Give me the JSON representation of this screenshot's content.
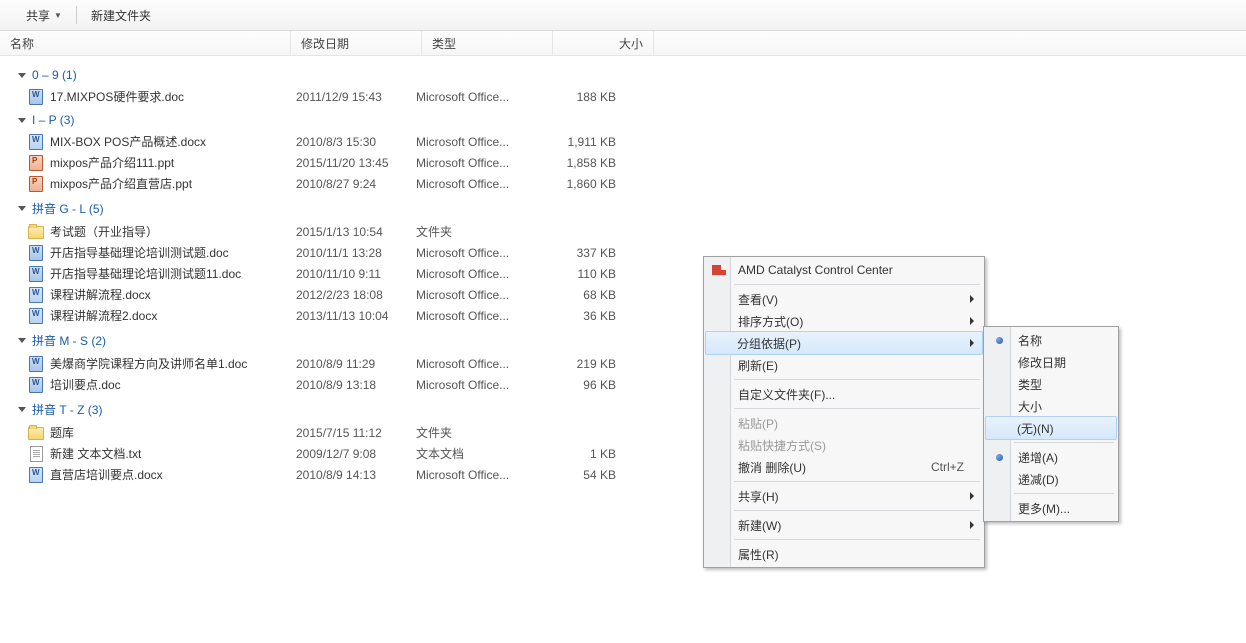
{
  "toolbar": {
    "share": "共享",
    "newFolder": "新建文件夹"
  },
  "columns": {
    "name": "名称",
    "date": "修改日期",
    "type": "类型",
    "size": "大小"
  },
  "groups": [
    {
      "label": "0 – 9 (1)",
      "items": [
        {
          "icon": "doc",
          "name": "17.MIXPOS硬件要求.doc",
          "date": "2011/12/9 15:43",
          "type": "Microsoft Office...",
          "size": "188 KB"
        }
      ]
    },
    {
      "label": "I – P (3)",
      "items": [
        {
          "icon": "docx",
          "name": "MIX-BOX POS产品概述.docx",
          "date": "2010/8/3 15:30",
          "type": "Microsoft Office...",
          "size": "1,911 KB"
        },
        {
          "icon": "ppt",
          "name": "mixpos产品介绍111.ppt",
          "date": "2015/11/20 13:45",
          "type": "Microsoft Office...",
          "size": "1,858 KB"
        },
        {
          "icon": "ppt",
          "name": "mixpos产品介绍直营店.ppt",
          "date": "2010/8/27 9:24",
          "type": "Microsoft Office...",
          "size": "1,860 KB"
        }
      ]
    },
    {
      "label": "拼音 G - L (5)",
      "items": [
        {
          "icon": "folder",
          "name": "考试题（开业指导）",
          "date": "2015/1/13 10:54",
          "type": "文件夹",
          "size": ""
        },
        {
          "icon": "doc",
          "name": "开店指导基础理论培训测试题.doc",
          "date": "2010/11/1 13:28",
          "type": "Microsoft Office...",
          "size": "337 KB"
        },
        {
          "icon": "doc",
          "name": "开店指导基础理论培训测试题11.doc",
          "date": "2010/11/10 9:11",
          "type": "Microsoft Office...",
          "size": "110 KB"
        },
        {
          "icon": "docx",
          "name": "课程讲解流程.docx",
          "date": "2012/2/23 18:08",
          "type": "Microsoft Office...",
          "size": "68 KB"
        },
        {
          "icon": "docx",
          "name": "课程讲解流程2.docx",
          "date": "2013/11/13 10:04",
          "type": "Microsoft Office...",
          "size": "36 KB"
        }
      ]
    },
    {
      "label": "拼音 M - S (2)",
      "items": [
        {
          "icon": "doc",
          "name": "美爆商学院课程方向及讲师名单1.doc",
          "date": "2010/8/9 11:29",
          "type": "Microsoft Office...",
          "size": "219 KB"
        },
        {
          "icon": "doc",
          "name": "培训要点.doc",
          "date": "2010/8/9 13:18",
          "type": "Microsoft Office...",
          "size": "96 KB"
        }
      ]
    },
    {
      "label": "拼音 T - Z (3)",
      "items": [
        {
          "icon": "folder",
          "name": "题库",
          "date": "2015/7/15 11:12",
          "type": "文件夹",
          "size": ""
        },
        {
          "icon": "txt",
          "name": "新建 文本文档.txt",
          "date": "2009/12/7 9:08",
          "type": "文本文档",
          "size": "1 KB"
        },
        {
          "icon": "docx",
          "name": "直营店培训要点.docx",
          "date": "2010/8/9 14:13",
          "type": "Microsoft Office...",
          "size": "54 KB"
        }
      ]
    }
  ],
  "ctx1": {
    "amd": "AMD Catalyst Control Center",
    "view": "查看(V)",
    "sort": "排序方式(O)",
    "groupBy": "分组依据(P)",
    "refresh": "刷新(E)",
    "customize": "自定义文件夹(F)...",
    "paste": "粘贴(P)",
    "pasteShortcut": "粘贴快捷方式(S)",
    "undo": "撤消 删除(U)",
    "undoKey": "Ctrl+Z",
    "shareWith": "共享(H)",
    "new": "新建(W)",
    "properties": "属性(R)"
  },
  "ctx2": {
    "name": "名称",
    "date": "修改日期",
    "type": "类型",
    "size": "大小",
    "none": "(无)(N)",
    "asc": "递增(A)",
    "desc": "递减(D)",
    "more": "更多(M)..."
  }
}
